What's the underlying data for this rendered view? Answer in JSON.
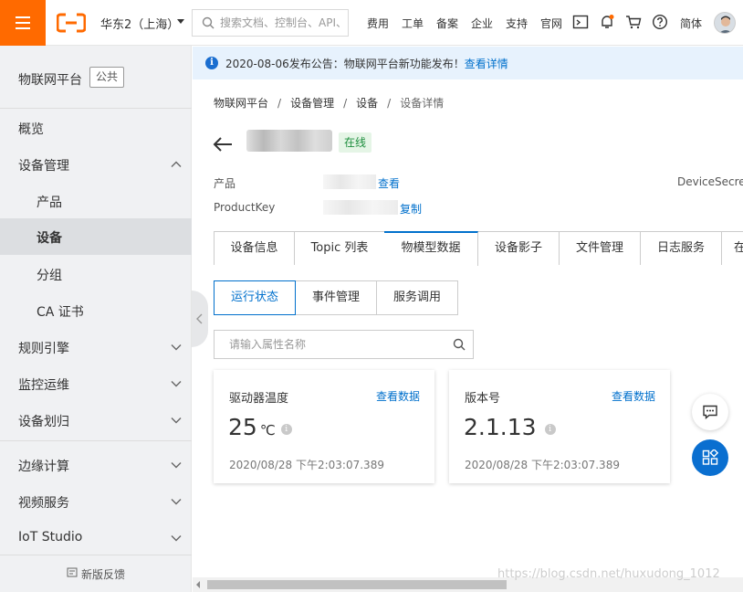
{
  "topbar": {
    "region": "华东2（上海）",
    "search_placeholder": "搜索文档、控制台、API、",
    "nav": [
      "费用",
      "工单",
      "备案",
      "企业",
      "支持",
      "官网"
    ],
    "lang": "简体",
    "accent": "#ff6a00"
  },
  "sidebar": {
    "title": "物联网平台",
    "badge": "公共",
    "items": [
      {
        "label": "概览"
      },
      {
        "label": "设备管理"
      },
      {
        "label": "产品"
      },
      {
        "label": "设备"
      },
      {
        "label": "分组"
      },
      {
        "label": "CA 证书"
      },
      {
        "label": "规则引擎"
      },
      {
        "label": "监控运维"
      },
      {
        "label": "设备划归"
      },
      {
        "label": "边缘计算"
      },
      {
        "label": "视频服务"
      },
      {
        "label": "IoT Studio"
      }
    ],
    "feedback": "新版反馈"
  },
  "notice": {
    "text": "2020-08-06发布公告：物联网平台新功能发布！",
    "link": "查看详情"
  },
  "breadcrumb": [
    "物联网平台",
    "设备管理",
    "设备",
    "设备详情"
  ],
  "device": {
    "status": "在线",
    "fields": {
      "product_label": "产品",
      "product_link": "查看",
      "productkey_label": "ProductKey",
      "productkey_link": "复制",
      "devicesecret_label": "DeviceSecret"
    }
  },
  "tabs": [
    "设备信息",
    "Topic 列表",
    "物模型数据",
    "设备影子",
    "文件管理",
    "日志服务",
    "在"
  ],
  "subtabs": [
    "运行状态",
    "事件管理",
    "服务调用"
  ],
  "attr_search_placeholder": "请输入属性名称",
  "cards": [
    {
      "title": "驱动器温度",
      "link": "查看数据",
      "value": "25",
      "unit": "℃",
      "time": "2020/08/28 下午2:03:07.389"
    },
    {
      "title": "版本号",
      "link": "查看数据",
      "value": "2.1.13",
      "unit": "",
      "time": "2020/08/28 下午2:03:07.389"
    }
  ],
  "watermark": "https://blog.csdn.net/huxudong_1012",
  "colors": {
    "link": "#0070cc",
    "online_bg": "#e5f5e6",
    "online_text": "#1e8e3e"
  }
}
